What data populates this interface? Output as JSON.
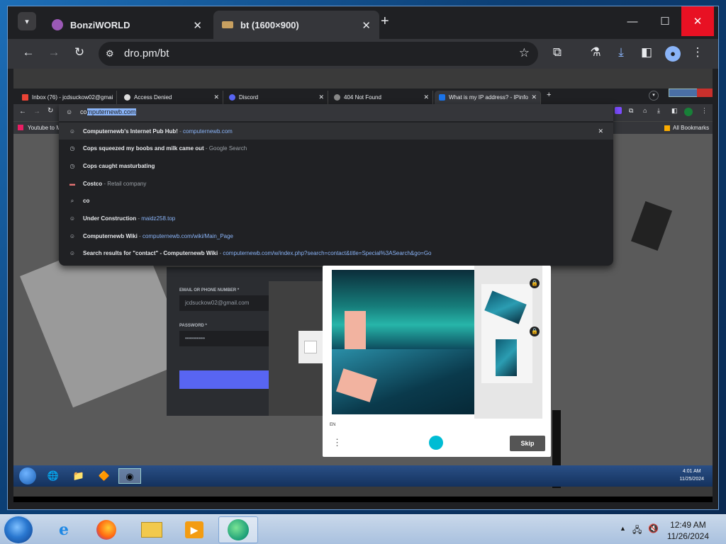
{
  "outer_browser": {
    "tabs": [
      {
        "title": "BonziWORLD"
      },
      {
        "title": "bt (1600×900)"
      }
    ],
    "new_tab": "+",
    "url": "dro.pm/bt",
    "window_controls": {
      "minimize": "—",
      "maximize": "☐",
      "close": "✕"
    }
  },
  "inner_browser": {
    "tabs": [
      {
        "title": "Inbox (76) - jcdsuckow02@gmai"
      },
      {
        "title": "Access Denied"
      },
      {
        "title": "Discord"
      },
      {
        "title": "404 Not Found"
      },
      {
        "title": "What is my IP address? - IPinfo"
      }
    ],
    "bookmarks": {
      "left": "Youtube to M",
      "right": "All Bookmarks"
    },
    "omnibox": {
      "typed": "co",
      "completion": "mputernewb.com"
    },
    "suggestions": [
      {
        "icon": "site-icon",
        "title": "Computernewb's Internet Pub Hub!",
        "sep": " - ",
        "detail": "computernewb.com",
        "detail_type": "link"
      },
      {
        "icon": "history-icon",
        "title": "Cops squeezed my boobs and milk came out",
        "sep": " - ",
        "detail": "Google Search",
        "detail_type": "text"
      },
      {
        "icon": "history-icon",
        "title": "Cops caught masturbating",
        "sep": "",
        "detail": "",
        "detail_type": "text"
      },
      {
        "icon": "costco-icon",
        "title": "Costco",
        "sep": " - ",
        "detail": "Retail company",
        "detail_type": "text"
      },
      {
        "icon": "search-icon",
        "title": "co",
        "sep": "",
        "detail": "",
        "detail_type": "text"
      },
      {
        "icon": "site-icon",
        "title": "Under Construction",
        "sep": " - ",
        "detail": "maidz258.top",
        "detail_type": "link"
      },
      {
        "icon": "site-icon",
        "title": "Computernewb Wiki",
        "sep": " - ",
        "detail": "computernewb.com/wiki/Main_Page",
        "detail_type": "link"
      },
      {
        "icon": "site-icon",
        "title": "Search results for \"contact\" - Computernewb Wiki",
        "sep": " - ",
        "detail": "computernewb.com/w/index.php?search=contact&title=Special%3ASearch&go=Go",
        "detail_type": "link"
      }
    ],
    "login": {
      "email_label": "EMAIL OR PHONE NUMBER *",
      "email_value": "jcdsuckow02@gmail.com",
      "password_label": "PASSWORD *",
      "password_value": "••••••••••"
    },
    "captcha": {
      "lang": "EN",
      "skip": "Skip"
    },
    "taskbar": {
      "time": "4:01 AM",
      "date": "11/25/2024"
    }
  },
  "taskbar": {
    "time": "12:49 AM",
    "date": "11/26/2024"
  },
  "colors": {
    "close_red": "#e81123",
    "chrome_dark": "#202124",
    "link_blue": "#8ab4f8"
  }
}
